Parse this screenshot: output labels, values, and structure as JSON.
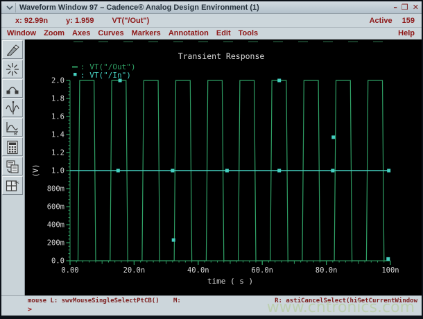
{
  "window": {
    "title": "Waveform Window 97 – Cadence® Analog Design Environment (1)",
    "controls": {
      "minimize": "–",
      "maximize": "❒",
      "close": "✕"
    }
  },
  "status": {
    "x_label": "x:",
    "x_value": "92.99n",
    "y_label": "y:",
    "y_value": "1.959",
    "trace": "VT(\"/Out\")",
    "active_label": "Active",
    "active_value": "159"
  },
  "menu": {
    "items": [
      "Window",
      "Zoom",
      "Axes",
      "Curves",
      "Markers",
      "Annotation",
      "Edit",
      "Tools"
    ],
    "right": "Help"
  },
  "toolbar": {
    "buttons": [
      {
        "icon": "marker-pen-icon"
      },
      {
        "icon": "crosshair-star-icon"
      },
      {
        "icon": "arc-curve-icon"
      },
      {
        "icon": "waveform-slice-icon"
      },
      {
        "icon": "waveform-b-icon"
      },
      {
        "icon": "calculator-icon"
      },
      {
        "icon": "duplicate-window-icon"
      },
      {
        "icon": "split-window-icon"
      }
    ]
  },
  "chart_data": {
    "type": "line",
    "title": "Transient Response",
    "xlabel": "time ( s )",
    "ylabel": "(V)",
    "x_unit": "ns",
    "xlim": [
      0,
      100
    ],
    "ylim": [
      0,
      2.0
    ],
    "grid": false,
    "legend_position": "top-left",
    "axis_color": "#2fa065",
    "text_color": "#d9d9d9",
    "x_ticks": [
      {
        "t": 0,
        "label": "0.00"
      },
      {
        "t": 20,
        "label": "20.0n"
      },
      {
        "t": 40,
        "label": "40.0n"
      },
      {
        "t": 60,
        "label": "60.0n"
      },
      {
        "t": 80,
        "label": "80.0n"
      },
      {
        "t": 100,
        "label": "100n"
      }
    ],
    "x_minor_step_ns": 2,
    "y_ticks": [
      {
        "v": 0.0,
        "label": "0.0"
      },
      {
        "v": 0.2,
        "label": "200m"
      },
      {
        "v": 0.4,
        "label": "400m"
      },
      {
        "v": 0.6,
        "label": "600m"
      },
      {
        "v": 0.8,
        "label": "800m"
      },
      {
        "v": 1.0,
        "label": "1.0"
      },
      {
        "v": 1.2,
        "label": "1.2"
      },
      {
        "v": 1.4,
        "label": "1.4"
      },
      {
        "v": 1.6,
        "label": "1.6"
      },
      {
        "v": 1.8,
        "label": "1.8"
      },
      {
        "v": 2.0,
        "label": "2.0"
      }
    ],
    "y_minor_step_v": 0.04,
    "legend": [
      {
        "swatch": "dash",
        "color": "#2fa065",
        "label": "VT(\"/Out\")"
      },
      {
        "swatch": "square",
        "color": "#45cfc0",
        "label": "VT(\"/In\")"
      }
    ],
    "series": [
      {
        "name": "VT(\"/Out\")",
        "color": "#2fa065",
        "type": "square_wave",
        "low_v": 0.0,
        "high_v": 2.0,
        "period_ns": 10,
        "first_rise_ns": 2.5,
        "duty": 0.5,
        "edge_ns": 0.5
      },
      {
        "name": "VT(\"/In\")",
        "color": "#45cfc0",
        "type": "constant_with_points",
        "value_v": 1.0,
        "marker_times_ns": [
          15,
          32,
          49,
          65.3,
          82,
          99.5
        ],
        "extra_markers": [
          {
            "t": 15.6,
            "v": 2.0
          },
          {
            "t": 32.3,
            "v": 0.23
          },
          {
            "t": 65.3,
            "v": 2.0
          },
          {
            "t": 82.2,
            "v": 1.37
          },
          {
            "t": 99.3,
            "v": 0.02
          }
        ]
      }
    ]
  },
  "footer": {
    "mouse_left": "mouse L: swvMouseSingleSelectPtCB()",
    "mouse_middle": "M:",
    "mouse_right": "R: astiCancelSelect(hiGetCurrentWindow",
    "prompt": ">"
  },
  "watermark": "www.cntronics.com"
}
